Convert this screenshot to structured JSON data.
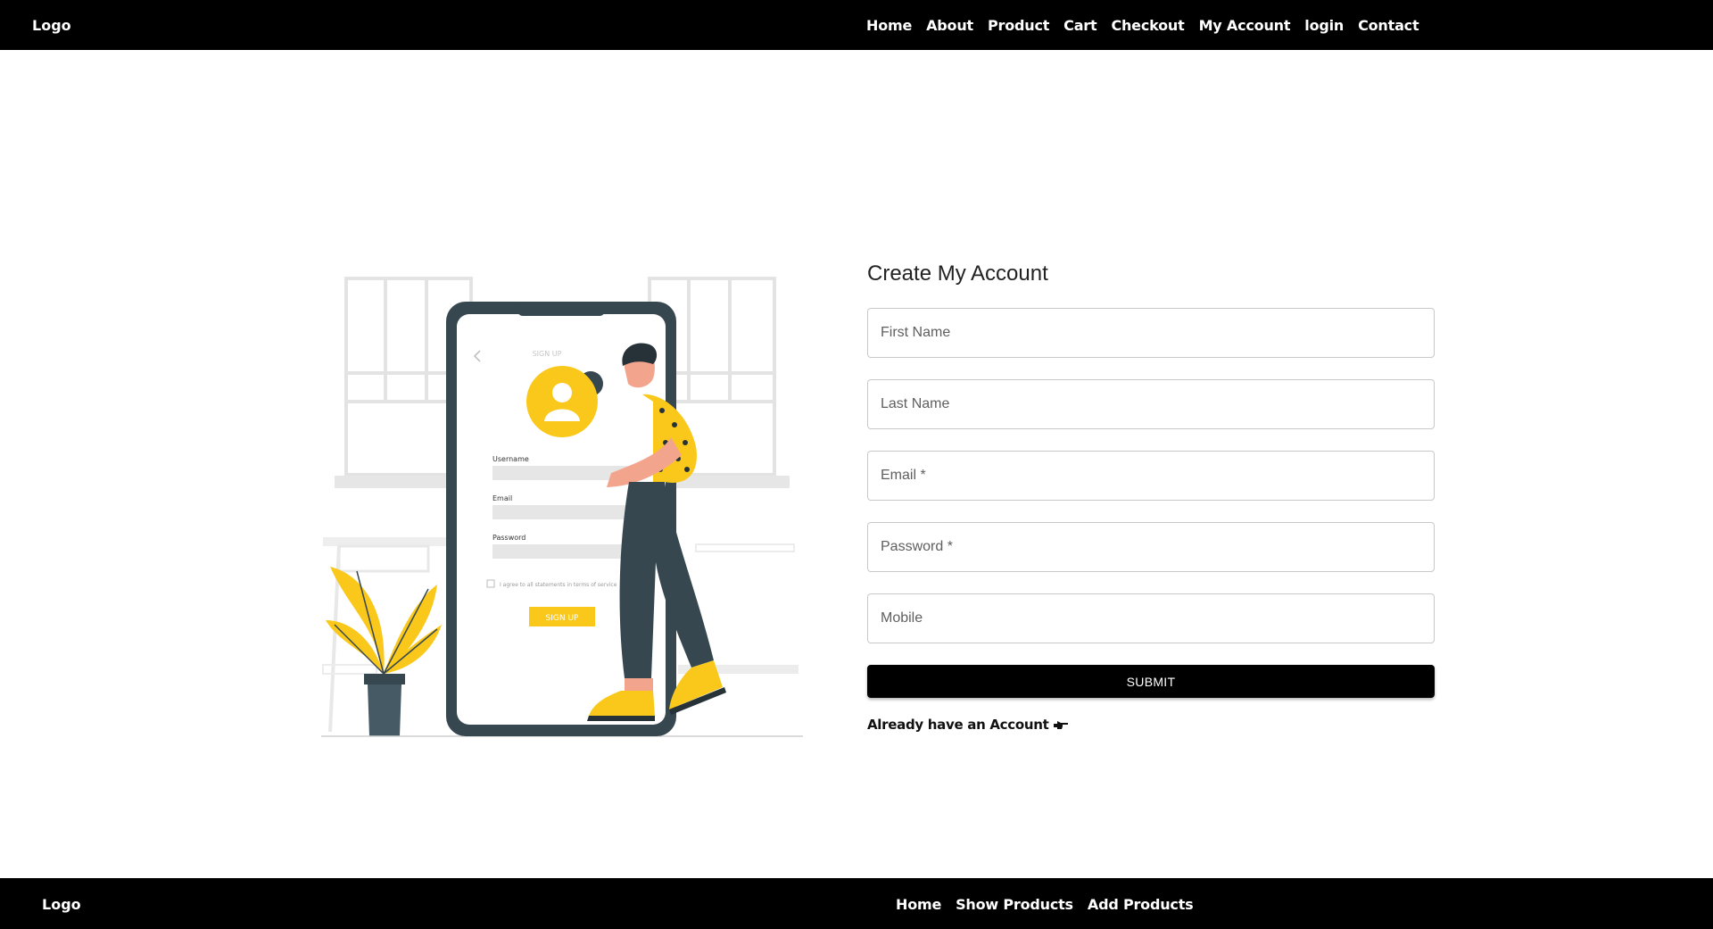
{
  "header": {
    "logo": "Logo",
    "nav": [
      "Home",
      "About",
      "Product",
      "Cart",
      "Checkout",
      "My Account",
      "login",
      "Contact"
    ]
  },
  "illustration": {
    "screen_title": "SIGN UP",
    "username_label": "Username",
    "email_label": "Email",
    "password_label": "Password",
    "terms_text": "I agree to all statements in terms of service",
    "button_label": "SIGN UP",
    "colors": {
      "accent": "#F9C81B",
      "dark": "#37474F",
      "light": "#E6E6E6"
    }
  },
  "form": {
    "title": "Create My Account",
    "fields": [
      {
        "name": "first-name",
        "placeholder": "First Name",
        "value": ""
      },
      {
        "name": "last-name",
        "placeholder": "Last Name",
        "value": ""
      },
      {
        "name": "email",
        "placeholder": "Email *",
        "value": ""
      },
      {
        "name": "password",
        "placeholder": "Password *",
        "value": ""
      },
      {
        "name": "mobile",
        "placeholder": "Mobile",
        "value": ""
      }
    ],
    "submit_label": "SUBMIT",
    "login_link": "Already have an Account",
    "login_icon": "pointing-hand-icon"
  },
  "footer": {
    "logo": "Logo",
    "nav": [
      "Home",
      "Show Products",
      "Add Products"
    ]
  }
}
